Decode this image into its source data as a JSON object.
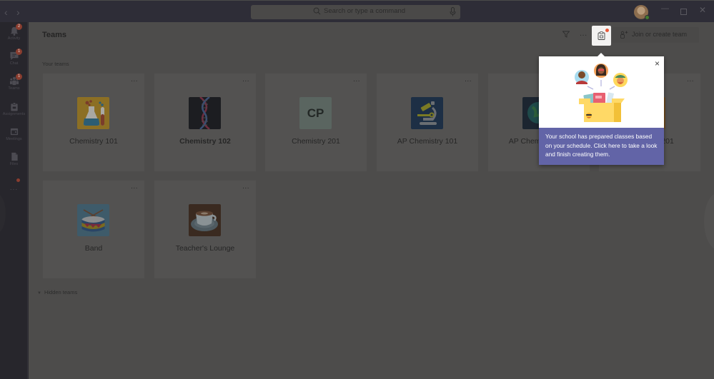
{
  "titlebar": {
    "back_icon": "chevron-left-icon",
    "forward_icon": "chevron-right-icon",
    "search_placeholder": "Search or type a command",
    "window_controls": [
      "minimize",
      "maximize",
      "close"
    ]
  },
  "rail": {
    "items": [
      {
        "label": "Activity",
        "icon": "bell-icon",
        "badge": "2"
      },
      {
        "label": "Chat",
        "icon": "chat-icon",
        "badge": "1"
      },
      {
        "label": "Teams",
        "icon": "teams-icon",
        "badge": "1"
      },
      {
        "label": "Assignments",
        "icon": "assignments-icon",
        "badge": ""
      },
      {
        "label": "Meetings",
        "icon": "calendar-icon",
        "badge": ""
      },
      {
        "label": "Files",
        "icon": "file-icon",
        "badge": ""
      }
    ],
    "more_label": "..."
  },
  "header": {
    "title": "Teams",
    "more_label": "...",
    "join_label": "Join or create team"
  },
  "sections": {
    "your_teams": "Your teams",
    "hidden_teams": "Hidden teams"
  },
  "teams": [
    {
      "name": "Chemistry 101",
      "logo": "flask-icon",
      "bold": false
    },
    {
      "name": "Chemistry 102",
      "logo": "dna-icon",
      "bold": true
    },
    {
      "name": "Chemistry 201",
      "logo": "initials",
      "initials": "CP",
      "bold": false
    },
    {
      "name": "AP Chemistry 101",
      "logo": "microscope-icon",
      "bold": false
    },
    {
      "name": "AP Chemistry 201",
      "logo": "globe-icon",
      "bold": false
    },
    {
      "name": "Chemistry 201",
      "logo": "orange-logo",
      "bold": false
    },
    {
      "name": "Band",
      "logo": "drum-icon",
      "bold": false
    },
    {
      "name": "Teacher's Lounge",
      "logo": "coffee-icon",
      "bold": false
    }
  ],
  "card_more_label": "...",
  "callout": {
    "text": "Your school has prepared classes based on your schedule. Click here to take a look and finish creating them.",
    "close_label": "×",
    "accent": "#6264a7"
  },
  "colors": {
    "accent": "#6264a7",
    "notification": "#e9593a"
  }
}
